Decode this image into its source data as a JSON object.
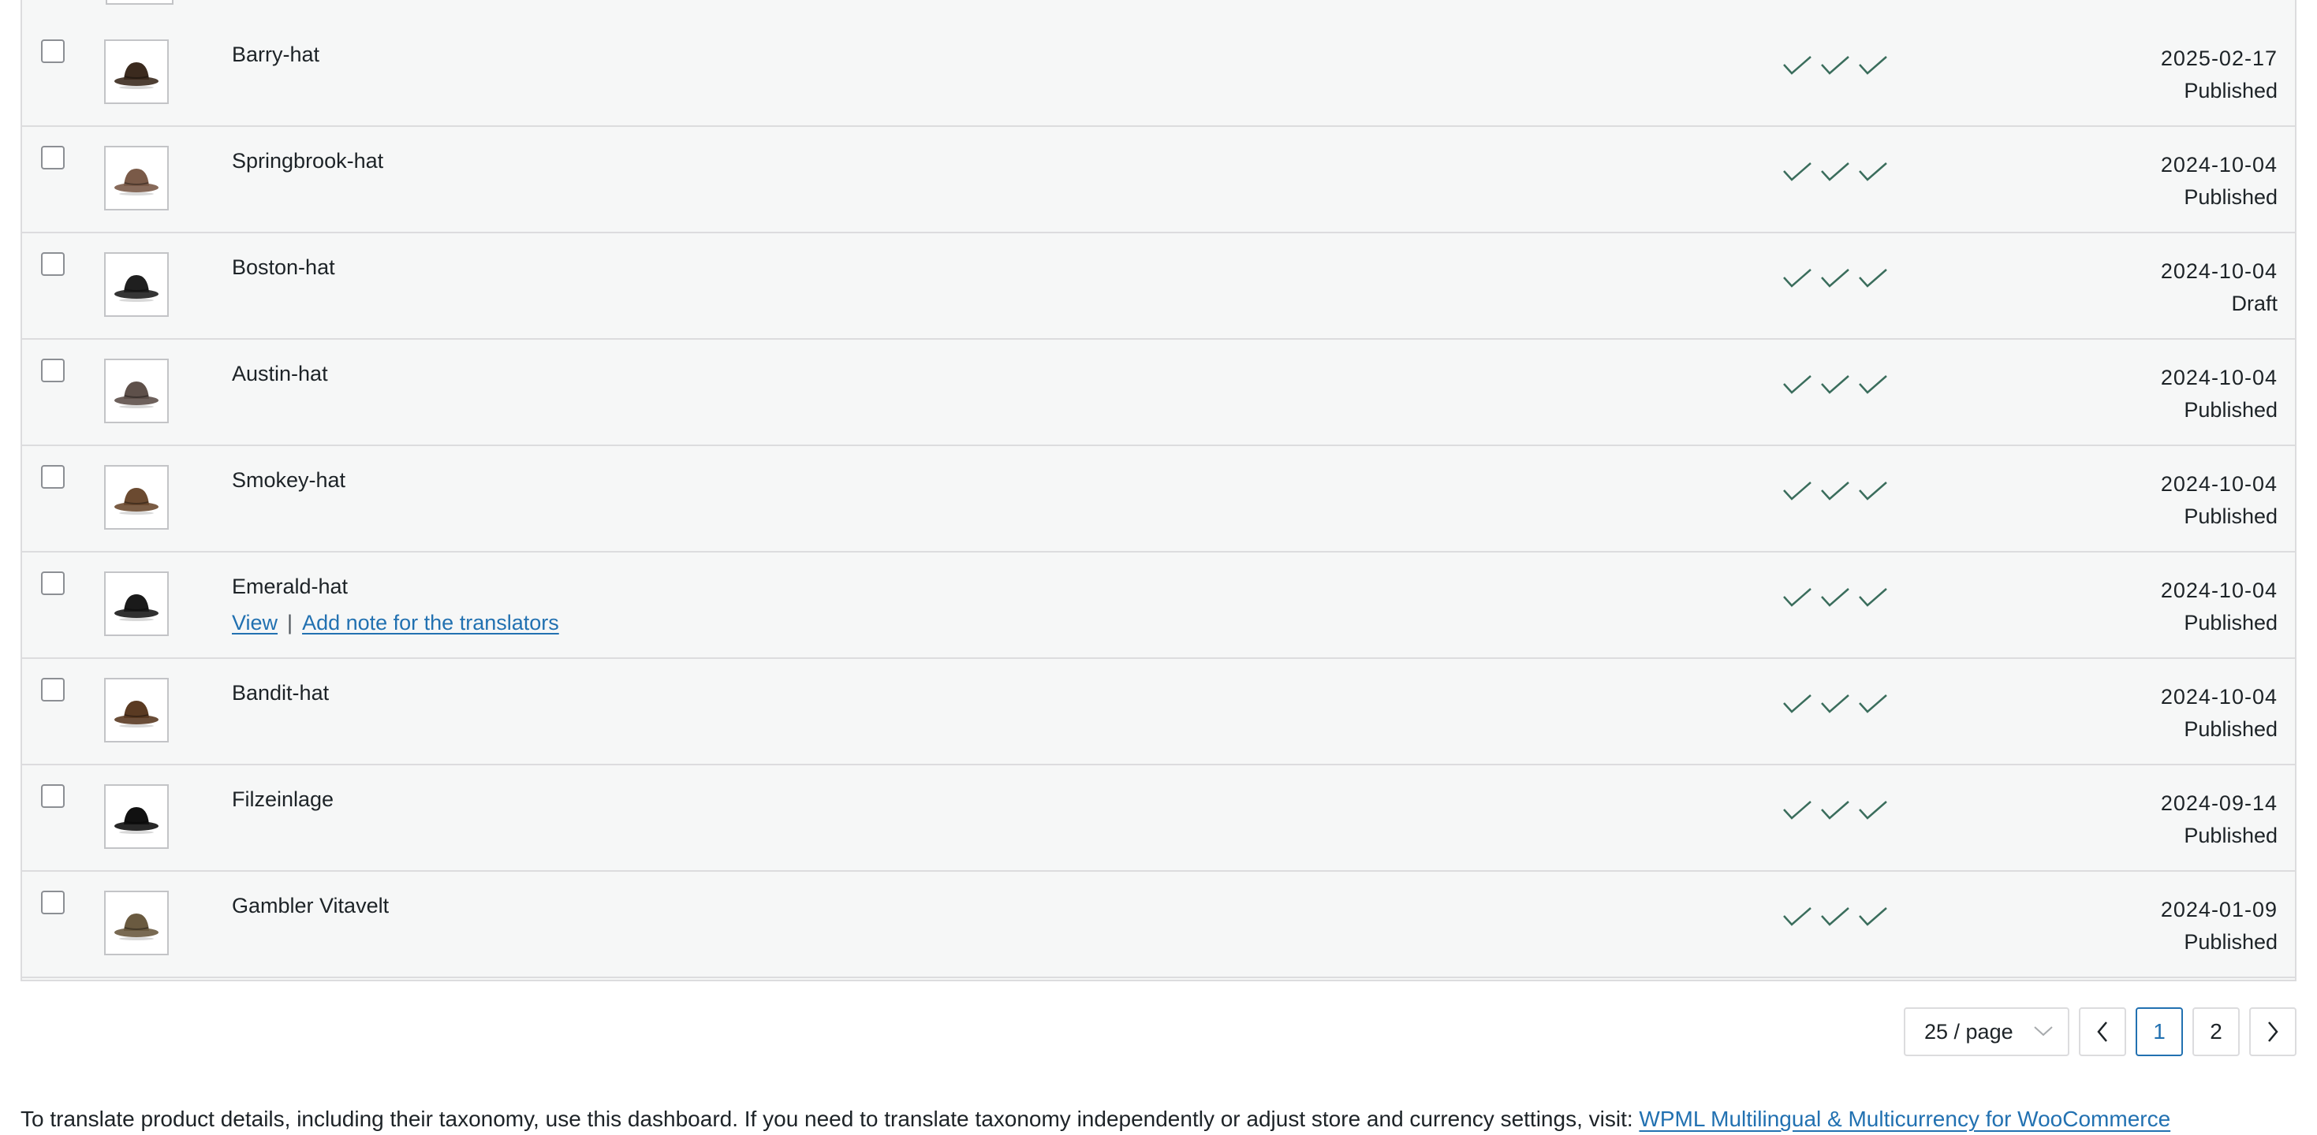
{
  "colors": {
    "check": "#3a6d5c",
    "link": "#2271b1",
    "border": "#dcdcde",
    "row_bg": "#f6f7f7"
  },
  "rows": [
    {
      "name": "Barry-hat",
      "date": "2025-02-17",
      "status": "Published",
      "hat_color": "#3b2a1e",
      "actions": null
    },
    {
      "name": "Springbrook-hat",
      "date": "2024-10-04",
      "status": "Published",
      "hat_color": "#7a5a48",
      "actions": null
    },
    {
      "name": "Boston-hat",
      "date": "2024-10-04",
      "status": "Draft",
      "hat_color": "#1f1f1f",
      "actions": null
    },
    {
      "name": "Austin-hat",
      "date": "2024-10-04",
      "status": "Published",
      "hat_color": "#5e504a",
      "actions": null
    },
    {
      "name": "Smokey-hat",
      "date": "2024-10-04",
      "status": "Published",
      "hat_color": "#6b4a30",
      "actions": null
    },
    {
      "name": "Emerald-hat",
      "date": "2024-10-04",
      "status": "Published",
      "hat_color": "#1a1a1a",
      "actions": {
        "view": "View",
        "separator": "|",
        "note": "Add note for the translators"
      }
    },
    {
      "name": "Bandit-hat",
      "date": "2024-10-04",
      "status": "Published",
      "hat_color": "#5a3a22",
      "actions": null
    },
    {
      "name": "Filzeinlage",
      "date": "2024-09-14",
      "status": "Published",
      "hat_color": "#111111",
      "actions": null
    },
    {
      "name": "Gambler Vitavelt",
      "date": "2024-01-09",
      "status": "Published",
      "hat_color": "#6a5a40",
      "actions": null
    }
  ],
  "pagination": {
    "per_page": "25 / page",
    "pages": [
      "1",
      "2"
    ],
    "current": "1"
  },
  "footer": {
    "text": "To translate product details, including their taxonomy, use this dashboard. If you need to translate taxonomy independently or adjust store and currency settings, visit: ",
    "link": "WPML Multilingual & Multicurrency for WooCommerce"
  }
}
